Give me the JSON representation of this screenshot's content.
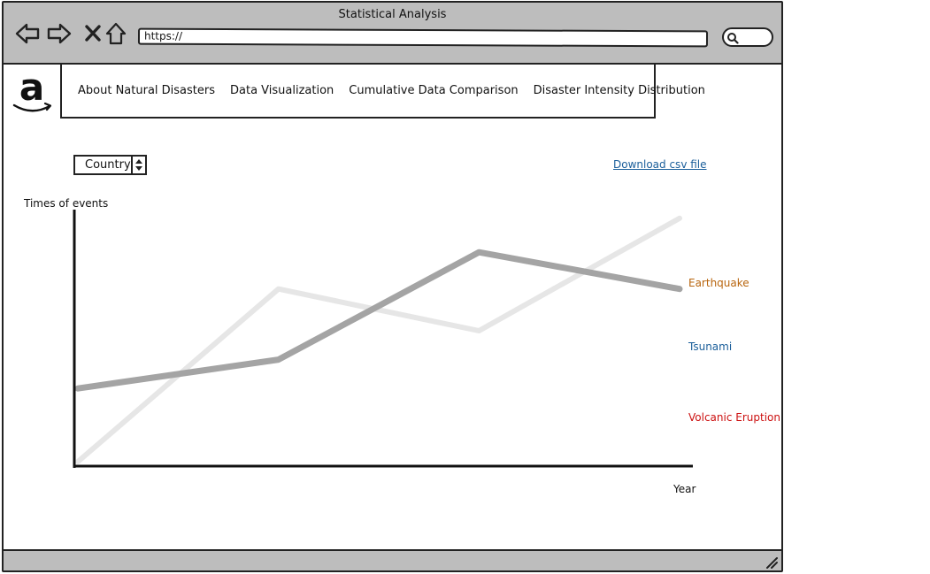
{
  "window": {
    "title": "Statistical Analysis"
  },
  "address_bar": {
    "url": "https://"
  },
  "navigation": {
    "items": [
      {
        "label": "About Natural Disasters"
      },
      {
        "label": "Data Visualization"
      },
      {
        "label": "Cumulative Data Comparison"
      },
      {
        "label": "Disaster Intensity Distribution"
      }
    ]
  },
  "controls": {
    "filter_select": {
      "value": "Country"
    },
    "download_link": "Download csv file"
  },
  "colors": {
    "earthquake": "#b8650e",
    "tsunami": "#1a5e9a",
    "volcanic_eruption": "#cc1111",
    "line_dark": "#a4a4a4",
    "line_light": "#e6e6e6",
    "chrome": "#bdbdbd"
  },
  "chart_data": {
    "type": "line",
    "xlabel": "Year",
    "ylabel": "Times of events",
    "x": [
      0,
      1,
      2,
      3
    ],
    "ylim": [
      0,
      100
    ],
    "series": [
      {
        "name": "Earthquake",
        "values": [
          29,
          40,
          81,
          67
        ]
      },
      {
        "name": "Tsunami",
        "values": [
          1,
          67,
          51,
          94
        ]
      },
      {
        "name": "Volcanic Eruption",
        "values": []
      }
    ],
    "legend_position": "right",
    "grid": false
  }
}
